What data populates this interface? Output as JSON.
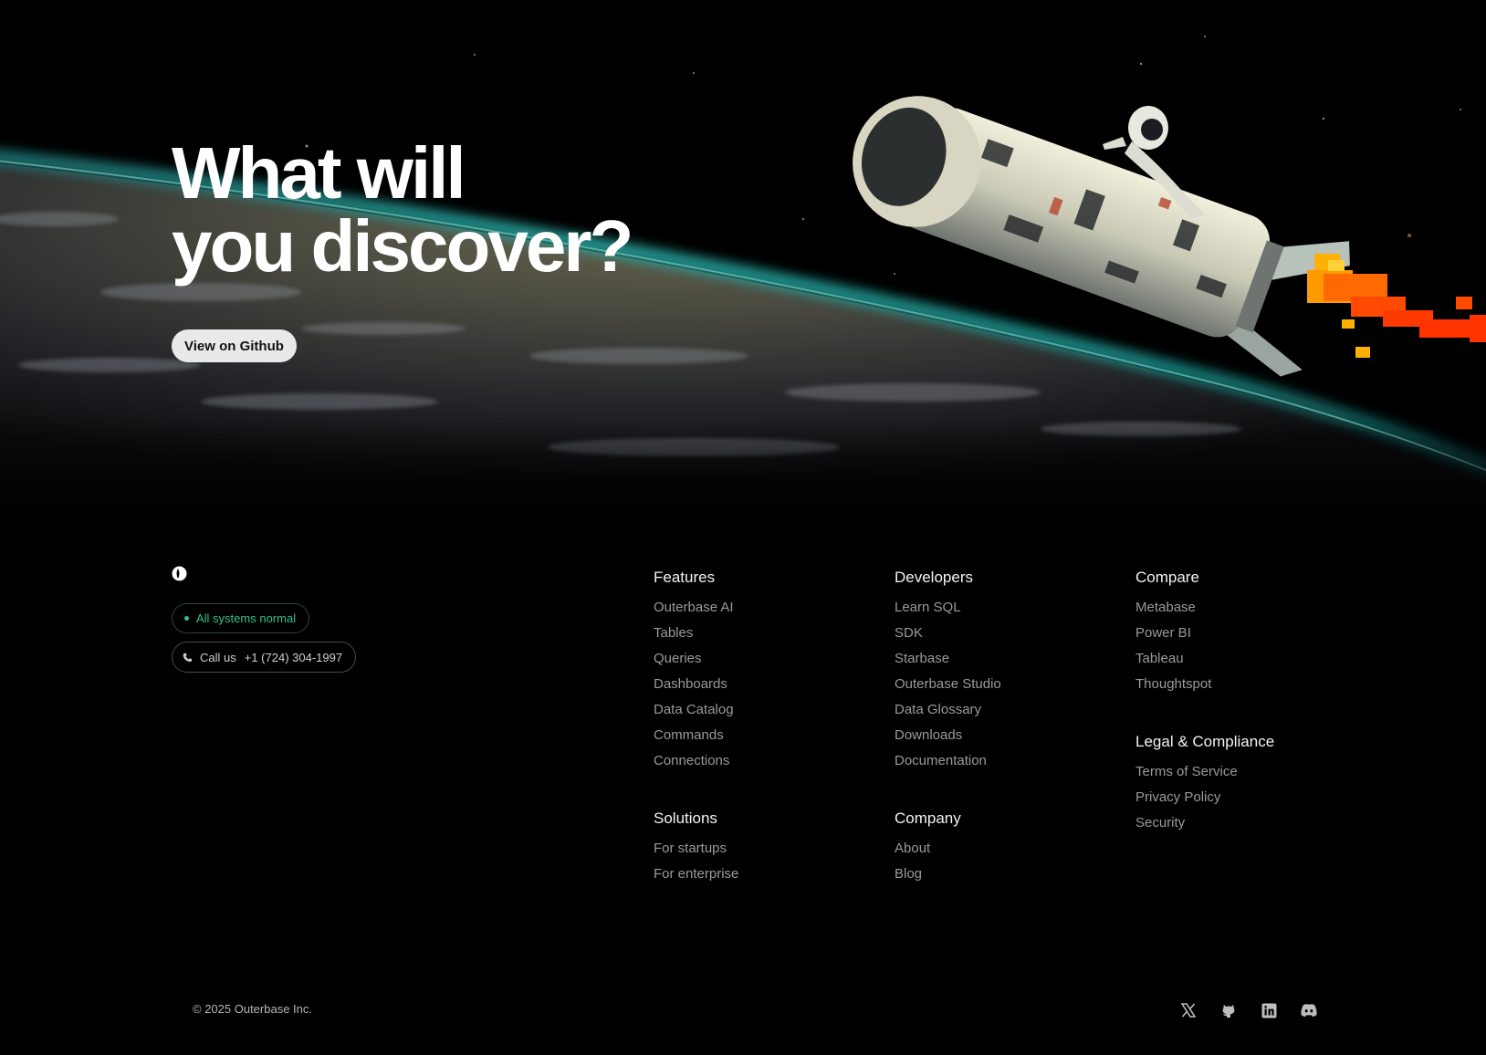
{
  "hero": {
    "title_line1": "What will",
    "title_line2": "you discover?",
    "cta_label": "View on Github"
  },
  "status": {
    "label": "All systems normal",
    "color": "#35c08a"
  },
  "contact": {
    "label": "Call us",
    "phone": "+1 (724) 304-1997",
    "icon": "phone-icon"
  },
  "footer": {
    "features": {
      "title": "Features",
      "items": [
        "Outerbase AI",
        "Tables",
        "Queries",
        "Dashboards",
        "Data Catalog",
        "Commands",
        "Connections"
      ]
    },
    "developers": {
      "title": "Developers",
      "items": [
        "Learn SQL",
        "SDK",
        "Starbase",
        "Outerbase Studio",
        "Data Glossary",
        "Downloads",
        "Documentation"
      ]
    },
    "compare": {
      "title": "Compare",
      "items": [
        "Metabase",
        "Power BI",
        "Tableau",
        "Thoughtspot"
      ]
    },
    "solutions": {
      "title": "Solutions",
      "items": [
        "For startups",
        "For enterprise"
      ]
    },
    "company": {
      "title": "Company",
      "items": [
        "About",
        "Blog"
      ]
    },
    "legal": {
      "title": "Legal & Compliance",
      "items": [
        "Terms of Service",
        "Privacy Policy",
        "Security"
      ]
    }
  },
  "copyright": "© 2025 Outerbase Inc.",
  "socials": [
    "x-icon",
    "github-icon",
    "linkedin-icon",
    "discord-icon"
  ]
}
